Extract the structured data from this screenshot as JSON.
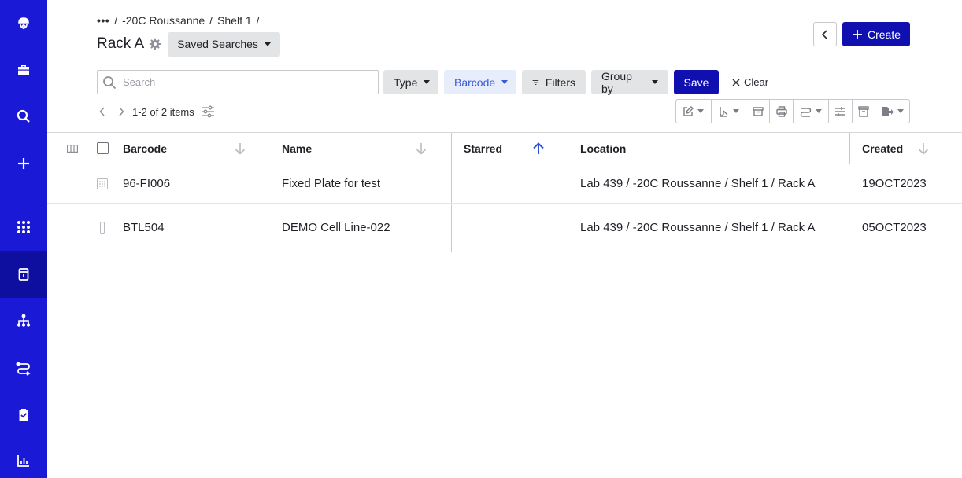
{
  "sidebar": {
    "items": [
      {
        "icon": "jellyfish-logo-icon"
      },
      {
        "icon": "briefcase-icon"
      },
      {
        "icon": "search-icon"
      },
      {
        "icon": "plus-icon"
      },
      {
        "icon": "apps-grid-icon"
      },
      {
        "icon": "inventory-box-icon",
        "active": true
      },
      {
        "icon": "hierarchy-icon"
      },
      {
        "icon": "workflow-icon"
      },
      {
        "icon": "clipboard-check-icon"
      },
      {
        "icon": "bar-chart-icon"
      }
    ]
  },
  "breadcrumb": {
    "ellipsis": "•••",
    "sep": "/",
    "items": [
      "-20C Roussanne",
      "Shelf 1"
    ]
  },
  "page": {
    "title": "Rack A",
    "saved_searches": "Saved Searches"
  },
  "header": {
    "create_label": "Create"
  },
  "filters": {
    "search_placeholder": "Search",
    "type_label": "Type",
    "barcode_label": "Barcode",
    "filters_label": "Filters",
    "group_by_label": "Group by",
    "save_label": "Save",
    "clear_label": "Clear"
  },
  "pager": {
    "text": "1-2 of 2 items"
  },
  "table": {
    "columns": [
      "Barcode",
      "Name",
      "Starred",
      "Location",
      "Created"
    ],
    "rows": [
      {
        "icon": "plate-grid-icon",
        "barcode": "96-FI006",
        "name": "Fixed Plate for test",
        "starred": "",
        "location": "Lab 439 / -20C Roussanne / Shelf 1 / Rack A",
        "created": "19OCT2023"
      },
      {
        "icon": "tube-icon",
        "barcode": "BTL504",
        "name": "DEMO Cell Line-022",
        "starred": "",
        "location": "Lab 439 / -20C Roussanne / Shelf 1 / Rack A",
        "created": "05OCT2023"
      }
    ]
  },
  "colors": {
    "sidebar": "#1a1ad6",
    "sidebar_active": "#0f0f9f",
    "primary": "#1010b0",
    "barcode_chip_bg": "#e7edfb",
    "barcode_chip_text": "#3a5ad9",
    "sort_active": "#2f4fd8"
  }
}
